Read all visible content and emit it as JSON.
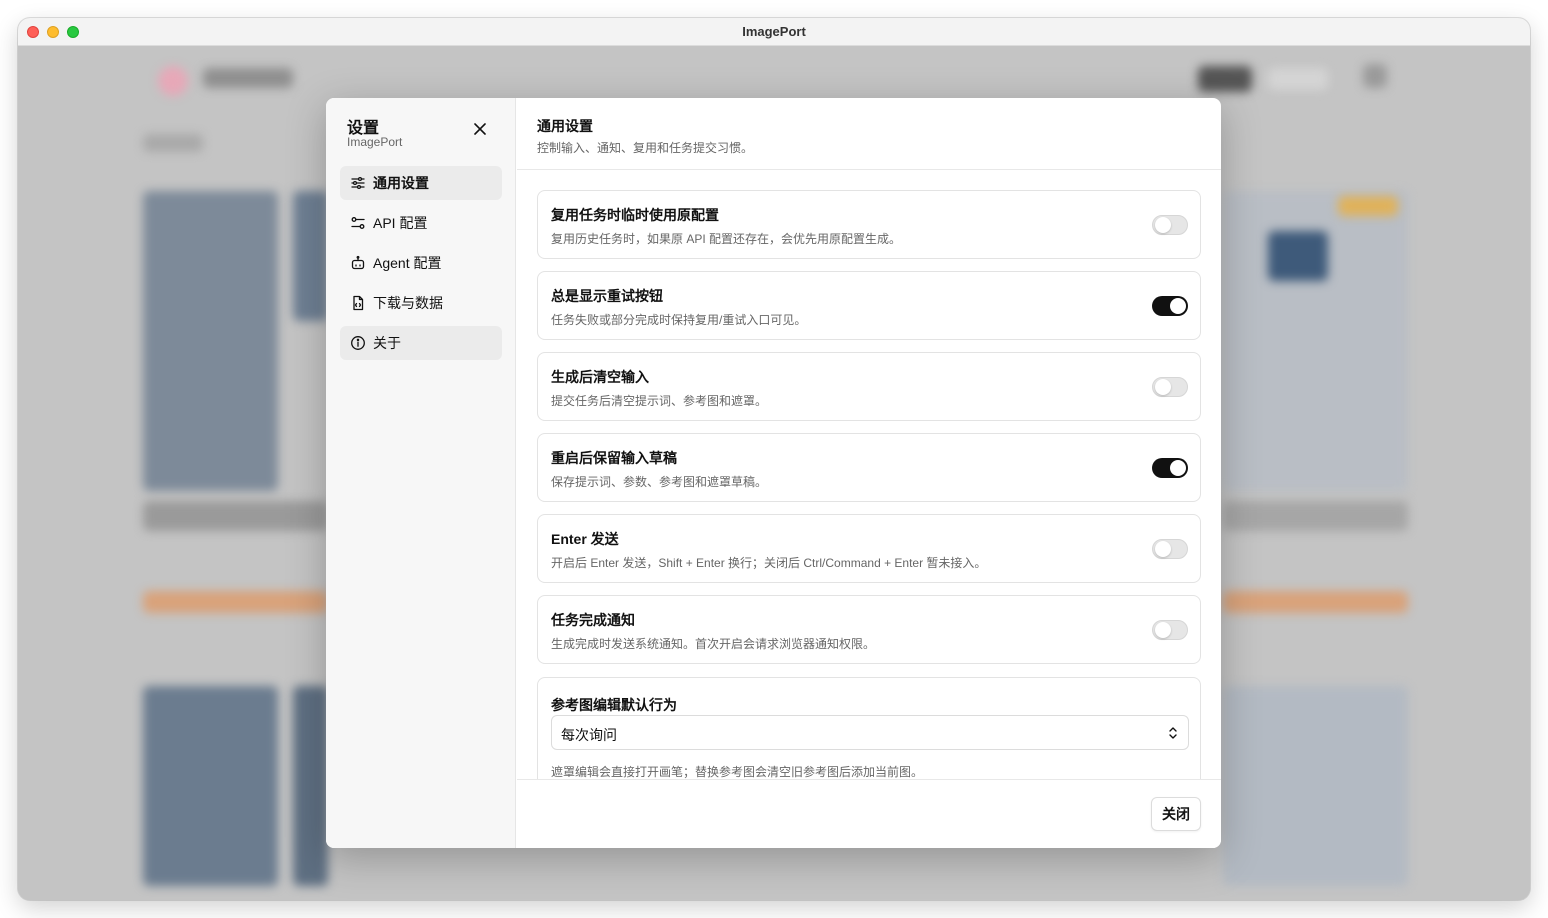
{
  "window": {
    "title": "ImagePort"
  },
  "sidebar": {
    "title": "设置",
    "subtitle": "ImagePort",
    "items": [
      {
        "label": "通用设置",
        "icon": "sliders-icon",
        "active": true
      },
      {
        "label": "API 配置",
        "icon": "api-icon",
        "active": false
      },
      {
        "label": "Agent 配置",
        "icon": "robot-icon",
        "active": false
      },
      {
        "label": "下载与数据",
        "icon": "file-icon",
        "active": false
      },
      {
        "label": "关于",
        "icon": "info-icon",
        "active": false
      }
    ]
  },
  "main": {
    "title": "通用设置",
    "description": "控制输入、通知、复用和任务提交习惯。",
    "settings": [
      {
        "title": "复用任务时临时使用原配置",
        "description": "复用历史任务时，如果原 API 配置还存在，会优先用原配置生成。",
        "enabled": false
      },
      {
        "title": "总是显示重试按钮",
        "description": "任务失败或部分完成时保持复用/重试入口可见。",
        "enabled": true
      },
      {
        "title": "生成后清空输入",
        "description": "提交任务后清空提示词、参考图和遮罩。",
        "enabled": false
      },
      {
        "title": "重启后保留输入草稿",
        "description": "保存提示词、参数、参考图和遮罩草稿。",
        "enabled": true
      },
      {
        "title": "Enter 发送",
        "description": "开启后 Enter 发送，Shift + Enter 换行；关闭后 Ctrl/Command + Enter 暂未接入。",
        "enabled": false
      },
      {
        "title": "任务完成通知",
        "description": "生成完成时发送系统通知。首次开启会请求浏览器通知权限。",
        "enabled": false
      }
    ],
    "ref_edit": {
      "label": "参考图编辑默认行为",
      "value": "每次询问",
      "description": "遮罩编辑会直接打开画笔；替换参考图会清空旧参考图后添加当前图。"
    },
    "close_label": "关闭"
  },
  "colors": {
    "toggle_on": "#111111",
    "toggle_off": "#e6e6e6",
    "traffic_red": "#fe5f57",
    "traffic_yellow": "#febc2e",
    "traffic_green": "#28c840"
  }
}
